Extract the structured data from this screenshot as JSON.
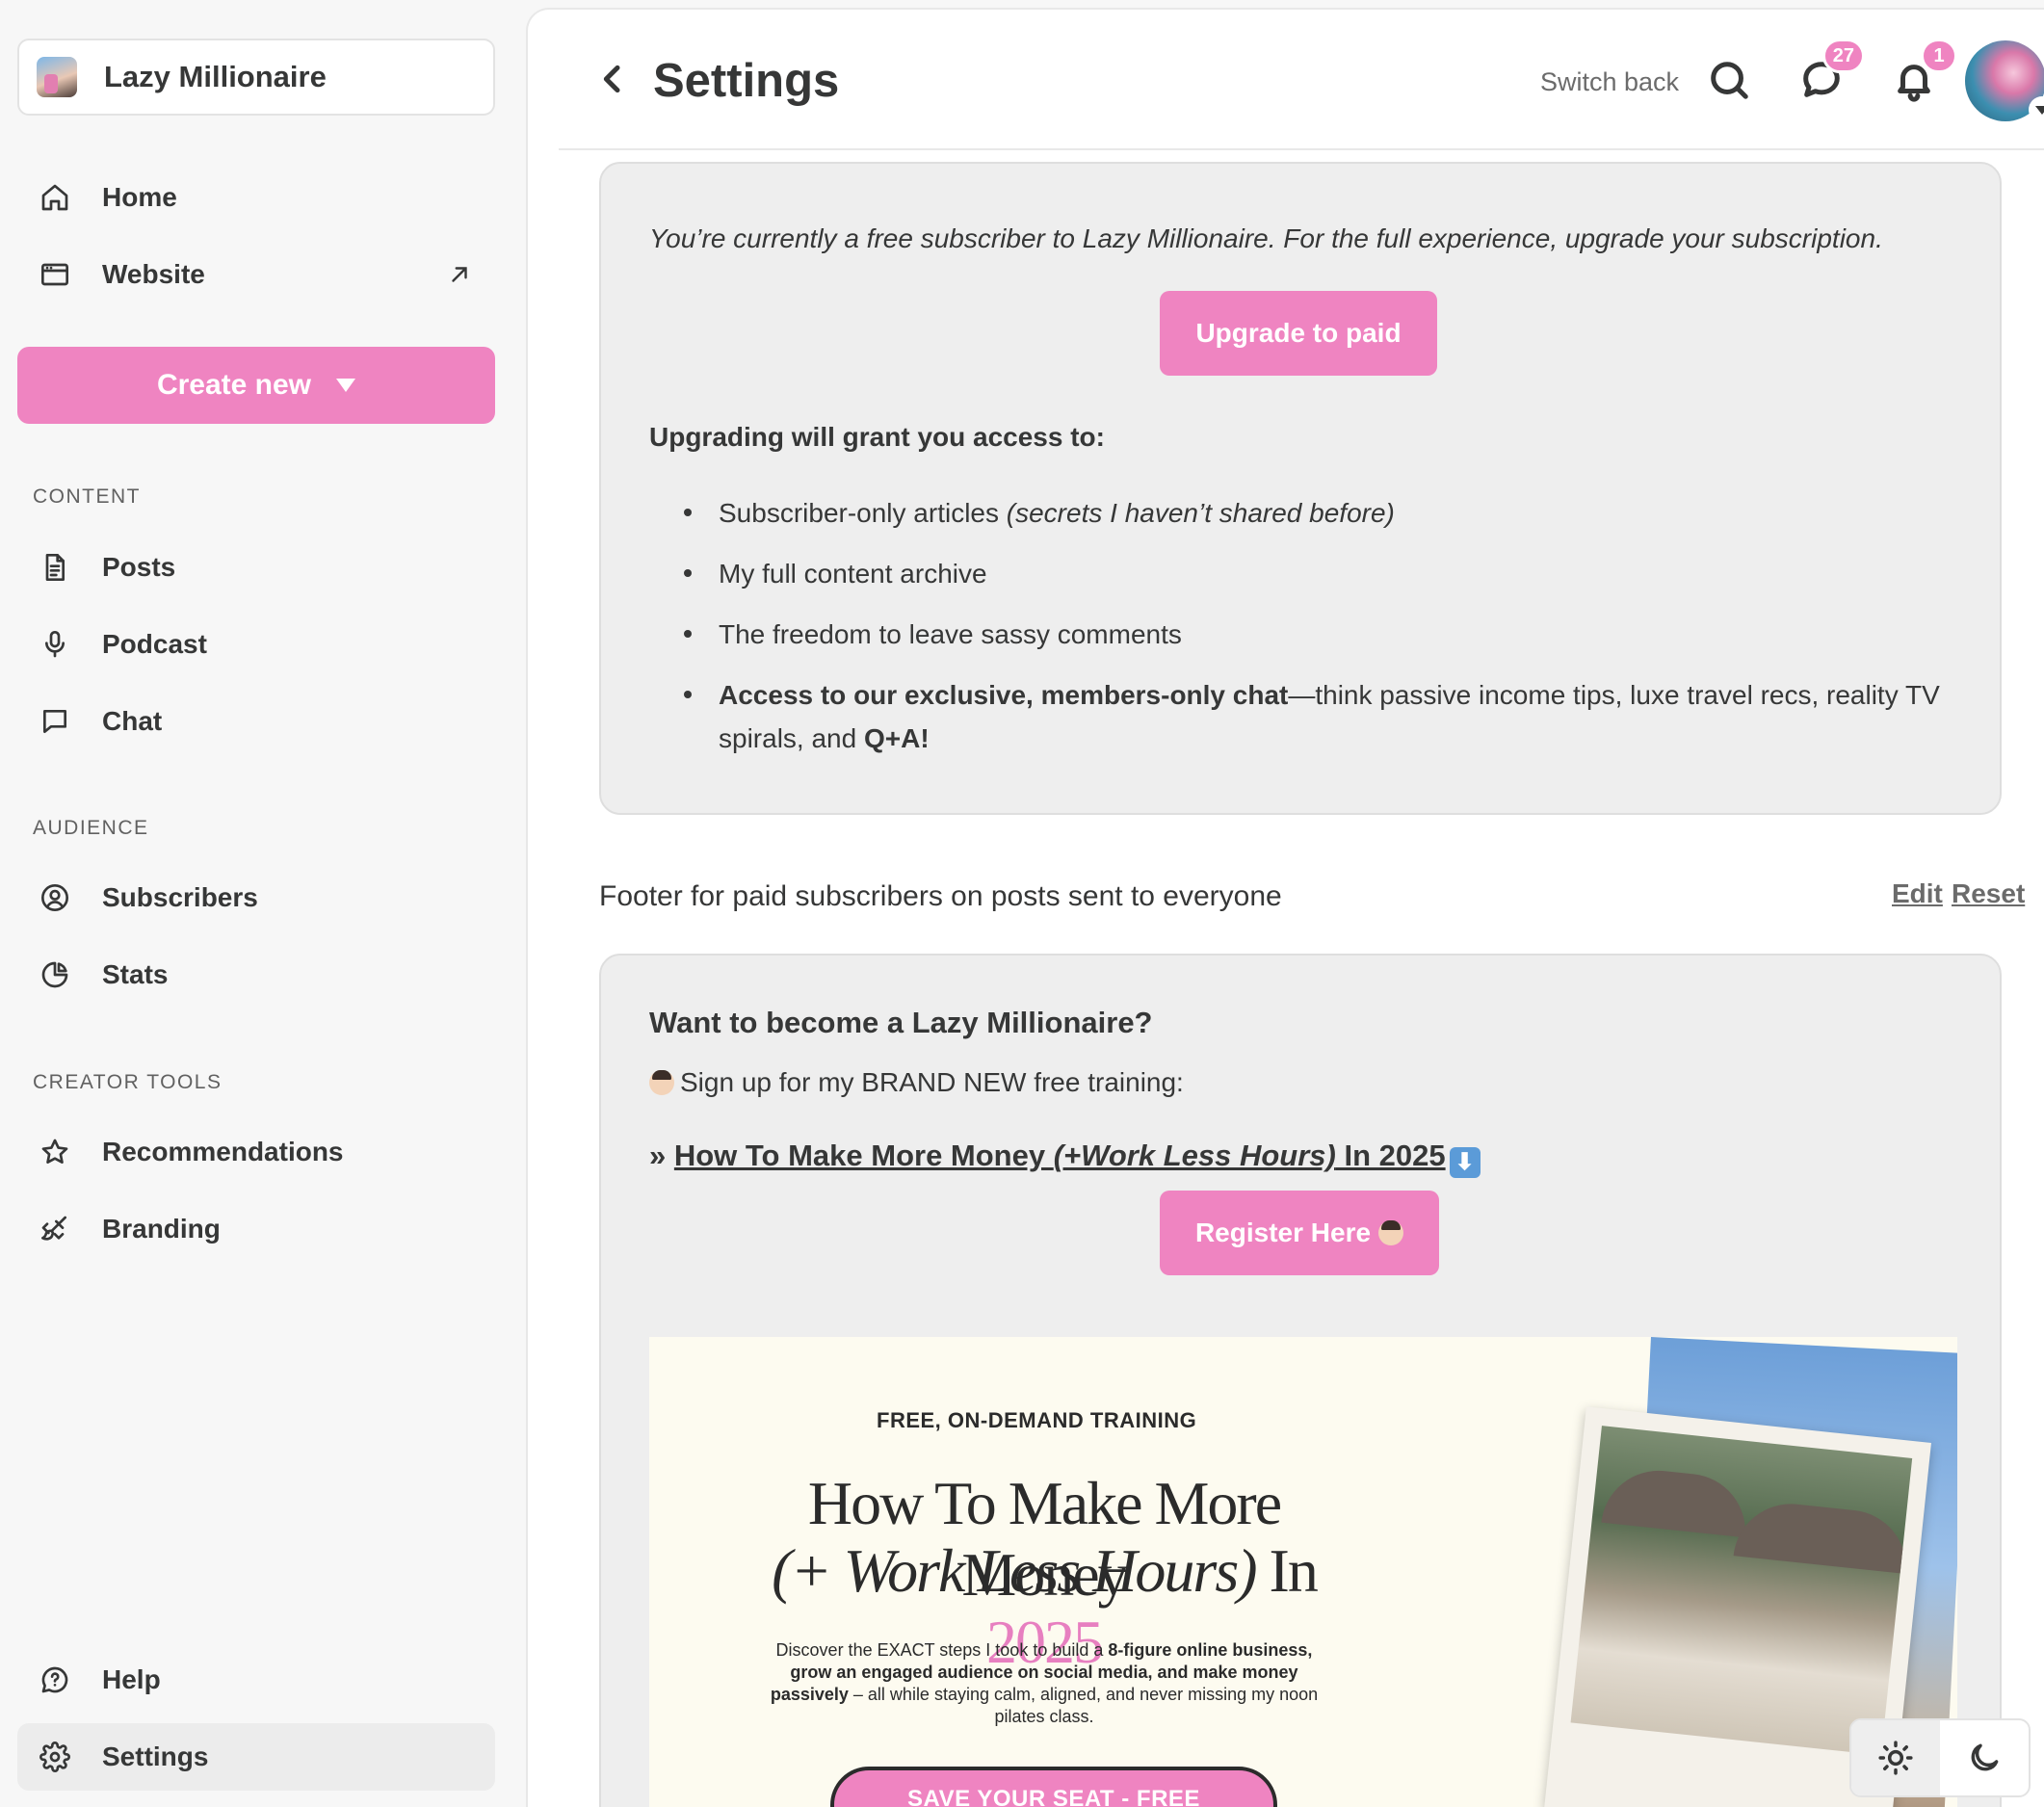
{
  "publication": {
    "name": "Lazy Millionaire"
  },
  "sidebar": {
    "top_items": [
      {
        "label": "Home",
        "icon": "home-icon"
      },
      {
        "label": "Website",
        "icon": "browser-window-icon"
      }
    ],
    "create_button": "Create new",
    "sections": [
      {
        "title": "CONTENT",
        "items": [
          {
            "label": "Posts",
            "icon": "document-icon"
          },
          {
            "label": "Podcast",
            "icon": "microphone-icon"
          },
          {
            "label": "Chat",
            "icon": "chat-bubble-icon"
          }
        ]
      },
      {
        "title": "AUDIENCE",
        "items": [
          {
            "label": "Subscribers",
            "icon": "user-circle-icon"
          },
          {
            "label": "Stats",
            "icon": "pie-chart-icon"
          }
        ]
      },
      {
        "title": "CREATOR TOOLS",
        "items": [
          {
            "label": "Recommendations",
            "icon": "star-icon"
          },
          {
            "label": "Branding",
            "icon": "paintbrush-icon"
          }
        ]
      }
    ],
    "bottom_items": [
      {
        "label": "Help",
        "icon": "help-bubble-icon"
      },
      {
        "label": "Settings",
        "icon": "gear-icon",
        "active": true
      }
    ]
  },
  "header": {
    "title": "Settings",
    "switch_back": "Switch back",
    "chat_badge": "27",
    "notification_badge": "1"
  },
  "free_footer": {
    "note": "You’re currently a free subscriber to Lazy Millionaire. For the full experience, upgrade your subscription.",
    "button": "Upgrade to paid",
    "access_heading": "Upgrading will grant you access to:",
    "perk1_main": "Subscriber-only articles ",
    "perk1_italic": "(secrets I haven’t shared before)",
    "perk2": "My full content archive",
    "perk3": "The freedom to leave sassy comments",
    "perk4_bold": "Access to our exclusive, members-only chat",
    "perk4_rest": "—think passive income tips, luxe travel recs, reality TV spirals, and ",
    "perk4_end": "Q+A!"
  },
  "paid_footer": {
    "label": "Footer for paid subscribers on posts sent to everyone",
    "edit": "Edit",
    "reset": "Reset",
    "title": "Want to become a Lazy Millionaire?",
    "signup_line": "Sign up for my BRAND NEW free training:",
    "link_prefix": "» ",
    "link_part1": "How To Make More Money ",
    "link_part2": "(+Work Less Hours)",
    "link_part3": " In 2025",
    "down_arrow": "⬇",
    "register_button": "Register Here"
  },
  "promo_image": {
    "kicker": "FREE, ON-DEMAND TRAINING",
    "title_line1": "How To Make More Money",
    "title_line2_italic": "(+ Work Less Hours)",
    "title_line2_in": " In ",
    "title_line2_year": "2025",
    "body_1": "Discover the EXACT steps I took to build a ",
    "body_2": "8-figure online business, grow an engaged audience on social media, and make money passively",
    "body_3": " – all while staying calm, aligned, and never missing my noon pilates class.",
    "cta": "SAVE YOUR SEAT - FREE"
  },
  "theme": {
    "light_icon": "sun-icon",
    "dark_icon": "moon-icon"
  },
  "colors": {
    "accent": "#ef84c1",
    "panel_bg": "#eeeeee",
    "text": "#363737"
  }
}
